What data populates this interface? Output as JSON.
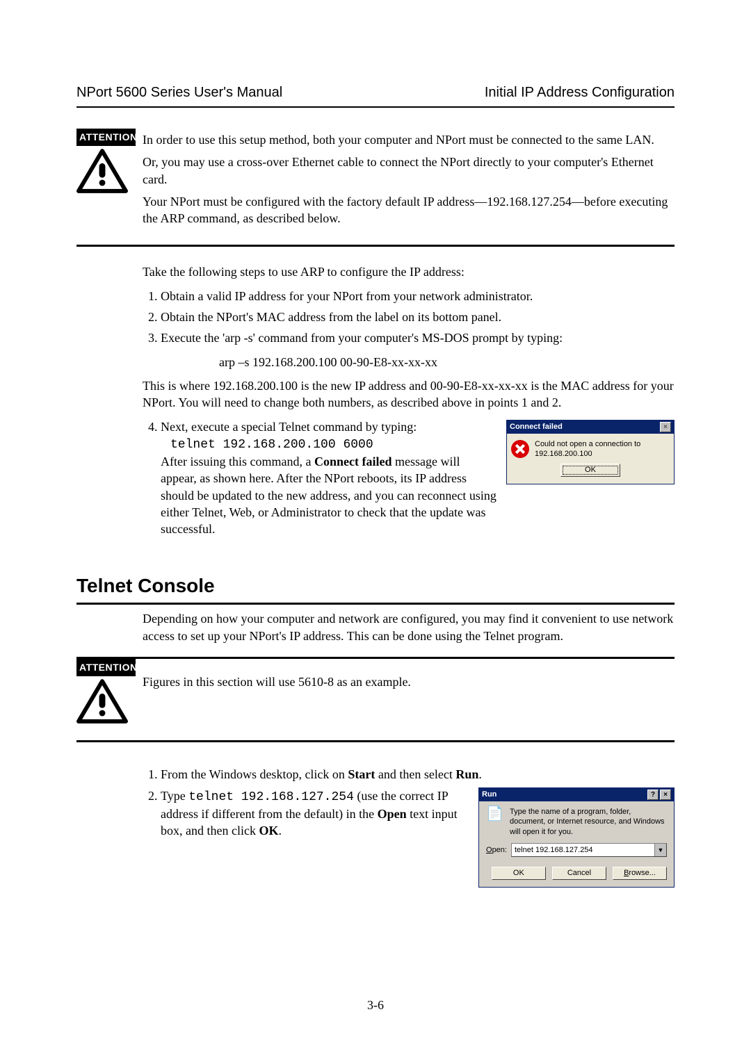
{
  "header": {
    "left": "NPort 5600 Series User's Manual",
    "right": "Initial IP Address Configuration"
  },
  "attention_label": "ATTENTION",
  "att1": {
    "p1": "In order to use this setup method, both your computer and NPort must be connected to the same LAN.",
    "p2": "Or, you may use a cross-over Ethernet cable to connect the NPort directly to your computer's Ethernet card.",
    "p3": "Your NPort must be configured with the factory default IP address—192.168.127.254—before executing the ARP command, as described below."
  },
  "arp_section": {
    "intro": "Take the following steps to use ARP to configure the IP address:",
    "step1": "Obtain a valid IP address for your NPort from your network administrator.",
    "step2": "Obtain the NPort's MAC address from the label on its bottom panel.",
    "step3": "Execute the 'arp -s' command from your computer's MS-DOS prompt by typing:",
    "arp_cmd": "arp –s 192.168.200.100 00-90-E8-xx-xx-xx",
    "explain": "This is where 192.168.200.100 is the new IP address and 00-90-E8-xx-xx-xx is the MAC address for your NPort. You will need to change both numbers, as described above in points 1 and 2.",
    "step4_lead": "Next, execute a special Telnet command by typing:",
    "step4_cmd": "telnet 192.168.200.100 6000",
    "step4_after_a": "After issuing this command, a ",
    "step4_after_bold": "Connect failed",
    "step4_after_b": " message will appear, as shown here. After the NPort reboots, its IP address should be updated to the new address, and you can reconnect using either Telnet, Web, or Administrator to check that the update was successful."
  },
  "connect_failed": {
    "title": "Connect failed",
    "msg": "Could not open a connection to 192.168.200.100",
    "ok": "OK"
  },
  "telnet_section": {
    "title": "Telnet Console",
    "intro": "Depending on how your computer and network are configured, you may find it convenient to use network access to set up your NPort's IP address. This can be done using the Telnet program.",
    "att2_text": "Figures in this section will use 5610-8 as an example.",
    "step1_a": "From the Windows desktop, click on ",
    "step1_start": "Start",
    "step1_b": " and then select ",
    "step1_run": "Run",
    "step1_c": ".",
    "step2_a": "Type ",
    "step2_code": "telnet 192.168.127.254",
    "step2_b": "  (use the correct IP address if different from the default) in the ",
    "step2_open": "Open",
    "step2_c": " text input box, and then click ",
    "step2_ok": "OK",
    "step2_d": "."
  },
  "run_dialog": {
    "title": "Run",
    "desc": "Type the name of a program, folder, document, or Internet resource, and Windows will open it for you.",
    "open_label": "Open:",
    "input_value": "telnet 192.168.127.254",
    "ok": "OK",
    "cancel": "Cancel",
    "browse": "Browse..."
  },
  "page_number": "3-6"
}
